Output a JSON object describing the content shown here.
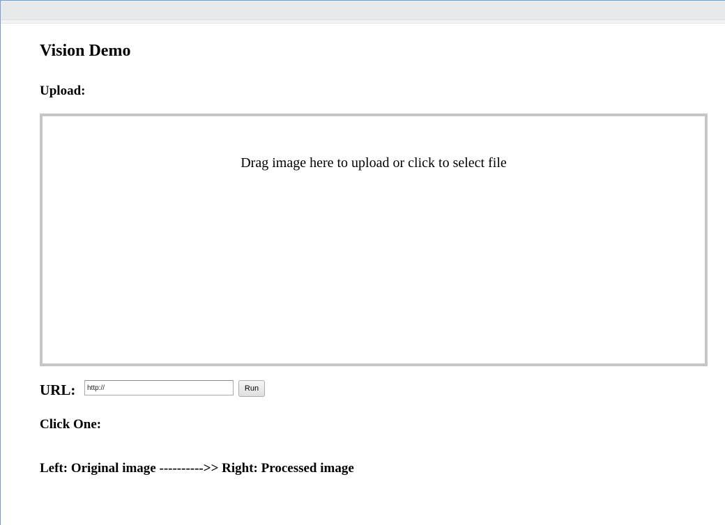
{
  "page": {
    "title": "Vision Demo"
  },
  "upload": {
    "label": "Upload:",
    "dropzone_text": "Drag image here to upload or click to select file"
  },
  "url_form": {
    "label": "URL:",
    "input_value": "http://",
    "run_label": "Run"
  },
  "samples": {
    "label": "Click One:"
  },
  "result": {
    "caption": "Left: Original image ---------->> Right: Processed image"
  },
  "colors": {
    "window_border": "#7a9cc8",
    "topbar_bg": "#e8e9ea",
    "dropzone_border": "#c6c6c6"
  }
}
